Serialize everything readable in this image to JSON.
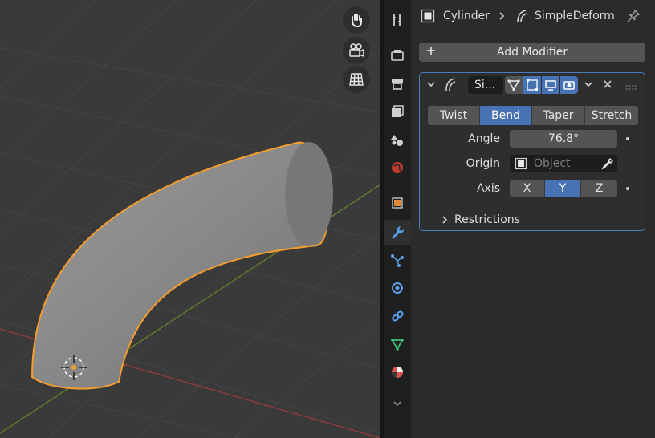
{
  "header": {
    "object_name": "Cylinder",
    "modifier_name": "SimpleDeform"
  },
  "toolbar": {
    "add_modifier_label": "Add Modifier"
  },
  "modifier": {
    "short_name": "Si...",
    "mode_tabs": [
      "Twist",
      "Bend",
      "Taper",
      "Stretch"
    ],
    "active_mode": "Bend",
    "angle_label": "Angle",
    "angle_value": "76.8°",
    "origin_label": "Origin",
    "origin_placeholder": "Object",
    "axis_label": "Axis",
    "axes": [
      "X",
      "Y",
      "Z"
    ],
    "active_axis": "Y",
    "restrictions_label": "Restrictions"
  },
  "colors": {
    "accent": "#4772b3",
    "selection_outline": "#f29c2e",
    "panel_border": "#4a7dbd"
  },
  "icons": [
    "hand-icon",
    "camera-icon",
    "grid-icon",
    "tool-icon",
    "render-icon",
    "output-icon",
    "view-layer-icon",
    "scene-icon",
    "world-icon",
    "object-icon",
    "wrench-icon",
    "particles-icon",
    "physics-icon",
    "constraints-icon",
    "data-icon",
    "material-icon"
  ]
}
